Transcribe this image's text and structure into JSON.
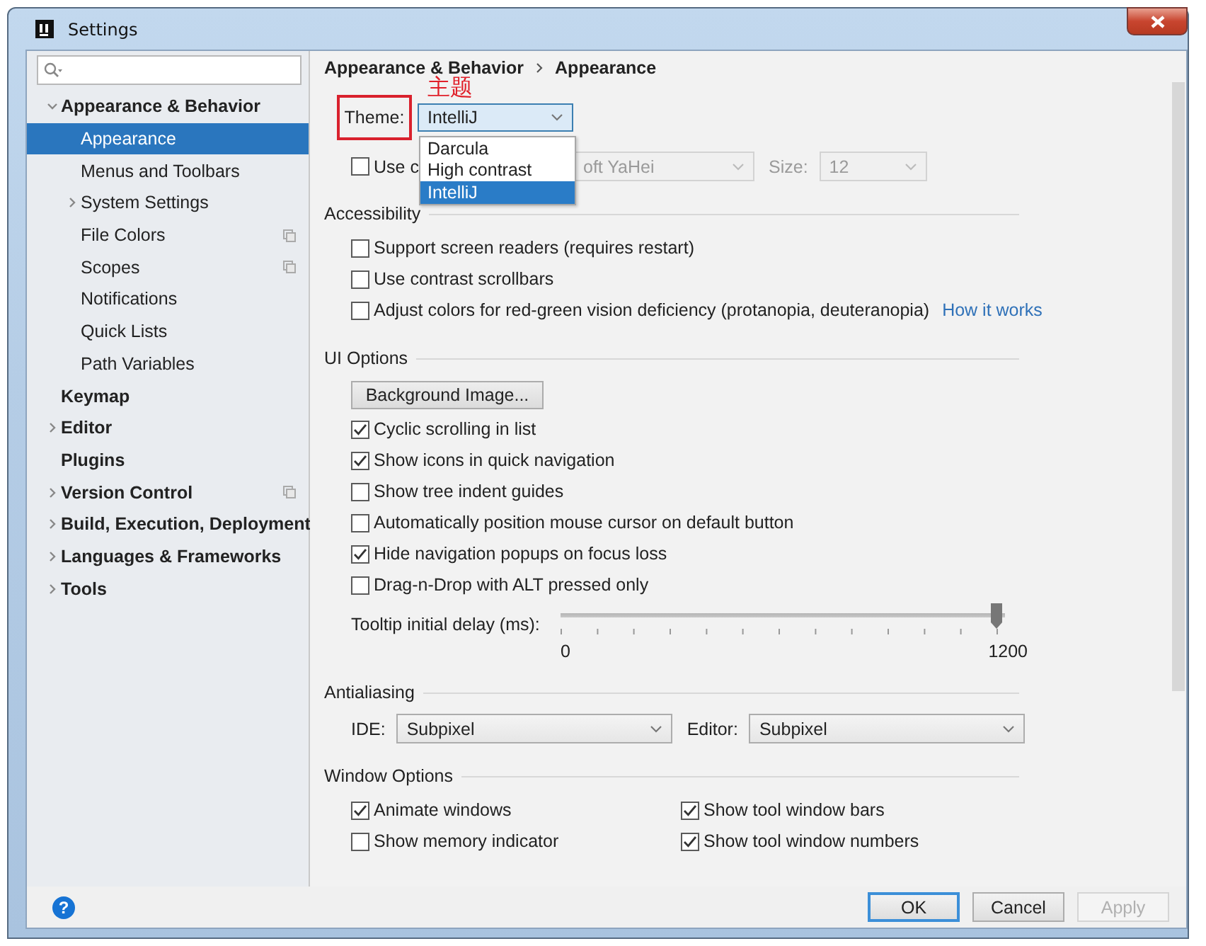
{
  "window": {
    "title": "Settings"
  },
  "sidebar": {
    "items": [
      {
        "label": "Appearance & Behavior",
        "bold": true,
        "selected": false,
        "expanded": true,
        "project_icon": false,
        "children": [
          {
            "label": "Appearance",
            "bold": false,
            "selected": true,
            "project_icon": false
          },
          {
            "label": "Menus and Toolbars",
            "bold": false,
            "selected": false,
            "project_icon": false
          },
          {
            "label": "System Settings",
            "bold": false,
            "selected": false,
            "expanded": false,
            "project_icon": false
          },
          {
            "label": "File Colors",
            "bold": false,
            "selected": false,
            "project_icon": true
          },
          {
            "label": "Scopes",
            "bold": false,
            "selected": false,
            "project_icon": true
          },
          {
            "label": "Notifications",
            "bold": false,
            "selected": false,
            "project_icon": false
          },
          {
            "label": "Quick Lists",
            "bold": false,
            "selected": false,
            "project_icon": false
          },
          {
            "label": "Path Variables",
            "bold": false,
            "selected": false,
            "project_icon": false
          }
        ]
      },
      {
        "label": "Keymap",
        "bold": true,
        "selected": false,
        "project_icon": false
      },
      {
        "label": "Editor",
        "bold": true,
        "selected": false,
        "expanded": false,
        "project_icon": false
      },
      {
        "label": "Plugins",
        "bold": true,
        "selected": false,
        "project_icon": false
      },
      {
        "label": "Version Control",
        "bold": true,
        "selected": false,
        "expanded": false,
        "project_icon": true
      },
      {
        "label": "Build, Execution, Deployment",
        "bold": true,
        "selected": false,
        "expanded": false,
        "project_icon": false
      },
      {
        "label": "Languages & Frameworks",
        "bold": true,
        "selected": false,
        "expanded": false,
        "project_icon": false
      },
      {
        "label": "Tools",
        "bold": true,
        "selected": false,
        "expanded": false,
        "project_icon": false
      }
    ]
  },
  "breadcrumb": [
    "Appearance & Behavior",
    "Appearance"
  ],
  "annotation": {
    "text": "主题"
  },
  "theme": {
    "label": "Theme:",
    "value": "IntelliJ",
    "options": [
      {
        "label": "Darcula",
        "selected": false
      },
      {
        "label": "High contrast",
        "selected": false
      },
      {
        "label": "IntelliJ",
        "selected": true
      }
    ]
  },
  "custom_font": {
    "label": "Use c",
    "checked": false,
    "font": "oft YaHei",
    "size_label": "Size:",
    "size": "12",
    "disabled": true
  },
  "sections": [
    {
      "title": "Accessibility",
      "items": [
        {
          "kind": "checkbox",
          "label": "Support screen readers (requires restart)",
          "checked": false
        },
        {
          "kind": "checkbox",
          "label": "Use contrast scrollbars",
          "checked": false
        },
        {
          "kind": "checkbox",
          "label": "Adjust colors for red-green vision deficiency (protanopia, deuteranopia)",
          "checked": false,
          "link": "How it works"
        }
      ]
    },
    {
      "title": "UI Options",
      "items": [
        {
          "kind": "button",
          "label": "Background Image..."
        },
        {
          "kind": "checkbox",
          "label": "Cyclic scrolling in list",
          "checked": true
        },
        {
          "kind": "checkbox",
          "label": "Show icons in quick navigation",
          "checked": true
        },
        {
          "kind": "checkbox",
          "label": "Show tree indent guides",
          "checked": false
        },
        {
          "kind": "checkbox",
          "label": "Automatically position mouse cursor on default button",
          "checked": false
        },
        {
          "kind": "checkbox",
          "label": "Hide navigation popups on focus loss",
          "checked": true
        },
        {
          "kind": "checkbox",
          "label": "Drag-n-Drop with ALT pressed only",
          "checked": false
        },
        {
          "kind": "slider",
          "label": "Tooltip initial delay (ms):",
          "level": 1,
          "min_label": "0",
          "max_label": "1200"
        }
      ]
    },
    {
      "title": "Antialiasing",
      "items": [
        {
          "kind": "combos",
          "combos": [
            {
              "label": "IDE:",
              "value": "Subpixel"
            },
            {
              "label": "Editor:",
              "value": "Subpixel"
            }
          ]
        }
      ]
    },
    {
      "title": "Window Options",
      "items": [
        {
          "kind": "pair",
          "checks": [
            {
              "label": "Animate windows",
              "checked": true
            },
            {
              "label": "Show tool window bars",
              "checked": true
            }
          ]
        },
        {
          "kind": "pair",
          "checks": [
            {
              "label": "Show memory indicator",
              "checked": false
            },
            {
              "label": "Show tool window numbers",
              "checked": true
            }
          ]
        }
      ]
    }
  ],
  "footer": {
    "help": "?",
    "buttons": [
      {
        "label": "OK",
        "default": true,
        "disabled": false
      },
      {
        "label": "Cancel",
        "default": false,
        "disabled": false
      },
      {
        "label": "Apply",
        "default": false,
        "disabled": true
      }
    ]
  }
}
